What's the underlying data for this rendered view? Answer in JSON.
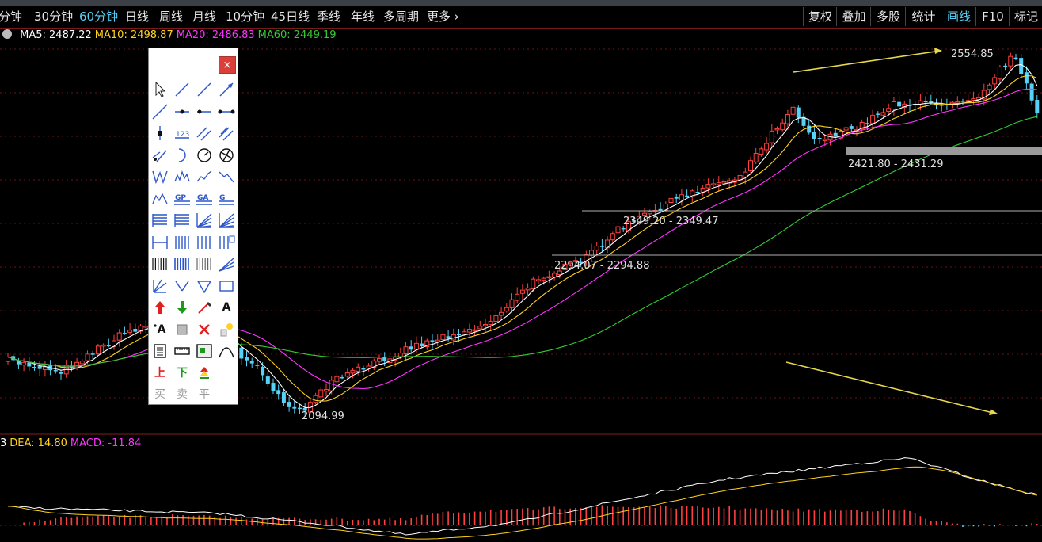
{
  "period_tabs": [
    {
      "label": "分钟",
      "active": false
    },
    {
      "label": "30分钟",
      "active": false
    },
    {
      "label": "60分钟",
      "active": true
    },
    {
      "label": "日线",
      "active": false
    },
    {
      "label": "周线",
      "active": false
    },
    {
      "label": "月线",
      "active": false
    },
    {
      "label": "10分钟",
      "active": false
    },
    {
      "label": "45日线",
      "active": false
    },
    {
      "label": "季线",
      "active": false
    },
    {
      "label": "年线",
      "active": false
    },
    {
      "label": "多周期",
      "active": false
    },
    {
      "label": "更多 ›",
      "active": false
    }
  ],
  "right_tabs": [
    {
      "label": "复权",
      "active": false
    },
    {
      "label": "叠加",
      "active": false
    },
    {
      "label": "多股",
      "active": false
    },
    {
      "label": "统计",
      "active": false
    },
    {
      "label": "画线",
      "active": true
    },
    {
      "label": "F10",
      "active": false
    },
    {
      "label": "标记",
      "active": false
    }
  ],
  "ma_legend": [
    {
      "text": "MA5: 2487.22",
      "color": "#ffffff"
    },
    {
      "text": "MA10: 2498.87",
      "color": "#ffd21f"
    },
    {
      "text": "MA20: 2486.83",
      "color": "#ff33ff"
    },
    {
      "text": "MA60: 2449.19",
      "color": "#33cc33"
    }
  ],
  "macd_legend": [
    {
      "text": "3",
      "color": "#ffffff"
    },
    {
      "text": "DEA: 14.80",
      "color": "#ffd21f"
    },
    {
      "text": "MACD: -11.84",
      "color": "#ff33ff"
    }
  ],
  "annotations": {
    "high_label": "2554.85",
    "low_label": "2094.99",
    "zone1": "2421.80 - 2431.29",
    "zone2": "2349.20 - 2349.47",
    "zone3": "2294.07 - 2294.88"
  },
  "toolbox": {
    "close_label": "×",
    "text_tool_label": "A",
    "text_tool2_label": "A",
    "buy_label": "买",
    "sell_label": "卖",
    "flat_label": "平",
    "up_label": "上",
    "down_label": "下"
  },
  "colors": {
    "up_candle": "#ff4040",
    "down_candle": "#57d1f5",
    "active_tab": "#57d1f5",
    "ma5": "#ffffff",
    "ma10": "#ffd21f",
    "ma20": "#ff33ff",
    "ma60": "#33cc33"
  }
}
